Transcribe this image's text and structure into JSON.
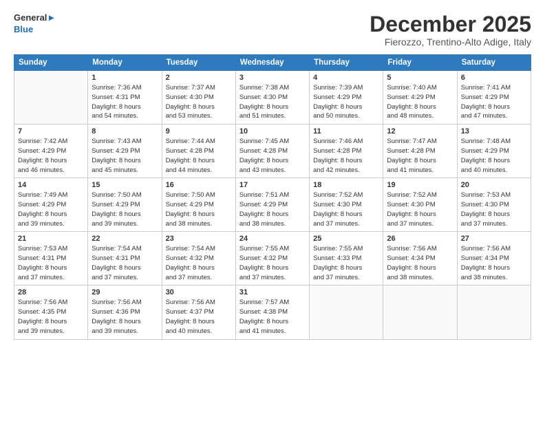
{
  "header": {
    "logo_line1": "General",
    "logo_line2": "Blue",
    "month": "December 2025",
    "location": "Fierozzo, Trentino-Alto Adige, Italy"
  },
  "weekdays": [
    "Sunday",
    "Monday",
    "Tuesday",
    "Wednesday",
    "Thursday",
    "Friday",
    "Saturday"
  ],
  "weeks": [
    [
      {
        "day": "",
        "info": ""
      },
      {
        "day": "1",
        "info": "Sunrise: 7:36 AM\nSunset: 4:31 PM\nDaylight: 8 hours\nand 54 minutes."
      },
      {
        "day": "2",
        "info": "Sunrise: 7:37 AM\nSunset: 4:30 PM\nDaylight: 8 hours\nand 53 minutes."
      },
      {
        "day": "3",
        "info": "Sunrise: 7:38 AM\nSunset: 4:30 PM\nDaylight: 8 hours\nand 51 minutes."
      },
      {
        "day": "4",
        "info": "Sunrise: 7:39 AM\nSunset: 4:29 PM\nDaylight: 8 hours\nand 50 minutes."
      },
      {
        "day": "5",
        "info": "Sunrise: 7:40 AM\nSunset: 4:29 PM\nDaylight: 8 hours\nand 48 minutes."
      },
      {
        "day": "6",
        "info": "Sunrise: 7:41 AM\nSunset: 4:29 PM\nDaylight: 8 hours\nand 47 minutes."
      }
    ],
    [
      {
        "day": "7",
        "info": "Sunrise: 7:42 AM\nSunset: 4:29 PM\nDaylight: 8 hours\nand 46 minutes."
      },
      {
        "day": "8",
        "info": "Sunrise: 7:43 AM\nSunset: 4:29 PM\nDaylight: 8 hours\nand 45 minutes."
      },
      {
        "day": "9",
        "info": "Sunrise: 7:44 AM\nSunset: 4:28 PM\nDaylight: 8 hours\nand 44 minutes."
      },
      {
        "day": "10",
        "info": "Sunrise: 7:45 AM\nSunset: 4:28 PM\nDaylight: 8 hours\nand 43 minutes."
      },
      {
        "day": "11",
        "info": "Sunrise: 7:46 AM\nSunset: 4:28 PM\nDaylight: 8 hours\nand 42 minutes."
      },
      {
        "day": "12",
        "info": "Sunrise: 7:47 AM\nSunset: 4:28 PM\nDaylight: 8 hours\nand 41 minutes."
      },
      {
        "day": "13",
        "info": "Sunrise: 7:48 AM\nSunset: 4:29 PM\nDaylight: 8 hours\nand 40 minutes."
      }
    ],
    [
      {
        "day": "14",
        "info": "Sunrise: 7:49 AM\nSunset: 4:29 PM\nDaylight: 8 hours\nand 39 minutes."
      },
      {
        "day": "15",
        "info": "Sunrise: 7:50 AM\nSunset: 4:29 PM\nDaylight: 8 hours\nand 39 minutes."
      },
      {
        "day": "16",
        "info": "Sunrise: 7:50 AM\nSunset: 4:29 PM\nDaylight: 8 hours\nand 38 minutes."
      },
      {
        "day": "17",
        "info": "Sunrise: 7:51 AM\nSunset: 4:29 PM\nDaylight: 8 hours\nand 38 minutes."
      },
      {
        "day": "18",
        "info": "Sunrise: 7:52 AM\nSunset: 4:30 PM\nDaylight: 8 hours\nand 37 minutes."
      },
      {
        "day": "19",
        "info": "Sunrise: 7:52 AM\nSunset: 4:30 PM\nDaylight: 8 hours\nand 37 minutes."
      },
      {
        "day": "20",
        "info": "Sunrise: 7:53 AM\nSunset: 4:30 PM\nDaylight: 8 hours\nand 37 minutes."
      }
    ],
    [
      {
        "day": "21",
        "info": "Sunrise: 7:53 AM\nSunset: 4:31 PM\nDaylight: 8 hours\nand 37 minutes."
      },
      {
        "day": "22",
        "info": "Sunrise: 7:54 AM\nSunset: 4:31 PM\nDaylight: 8 hours\nand 37 minutes."
      },
      {
        "day": "23",
        "info": "Sunrise: 7:54 AM\nSunset: 4:32 PM\nDaylight: 8 hours\nand 37 minutes."
      },
      {
        "day": "24",
        "info": "Sunrise: 7:55 AM\nSunset: 4:32 PM\nDaylight: 8 hours\nand 37 minutes."
      },
      {
        "day": "25",
        "info": "Sunrise: 7:55 AM\nSunset: 4:33 PM\nDaylight: 8 hours\nand 37 minutes."
      },
      {
        "day": "26",
        "info": "Sunrise: 7:56 AM\nSunset: 4:34 PM\nDaylight: 8 hours\nand 38 minutes."
      },
      {
        "day": "27",
        "info": "Sunrise: 7:56 AM\nSunset: 4:34 PM\nDaylight: 8 hours\nand 38 minutes."
      }
    ],
    [
      {
        "day": "28",
        "info": "Sunrise: 7:56 AM\nSunset: 4:35 PM\nDaylight: 8 hours\nand 39 minutes."
      },
      {
        "day": "29",
        "info": "Sunrise: 7:56 AM\nSunset: 4:36 PM\nDaylight: 8 hours\nand 39 minutes."
      },
      {
        "day": "30",
        "info": "Sunrise: 7:56 AM\nSunset: 4:37 PM\nDaylight: 8 hours\nand 40 minutes."
      },
      {
        "day": "31",
        "info": "Sunrise: 7:57 AM\nSunset: 4:38 PM\nDaylight: 8 hours\nand 41 minutes."
      },
      {
        "day": "",
        "info": ""
      },
      {
        "day": "",
        "info": ""
      },
      {
        "day": "",
        "info": ""
      }
    ]
  ]
}
